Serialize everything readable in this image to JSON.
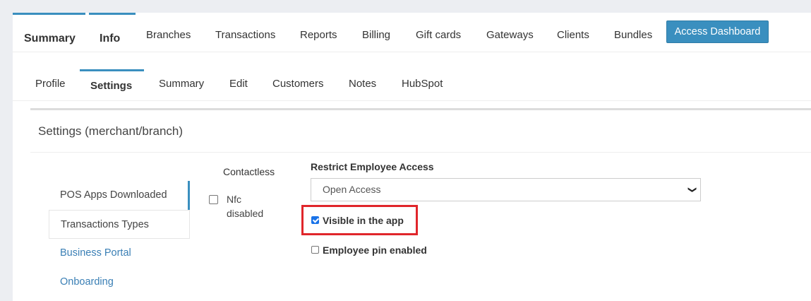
{
  "top_tabs": [
    {
      "label": "Summary",
      "active": true
    },
    {
      "label": "Info",
      "active": true
    },
    {
      "label": "Branches"
    },
    {
      "label": "Transactions"
    },
    {
      "label": "Reports"
    },
    {
      "label": "Billing"
    },
    {
      "label": "Gift cards"
    },
    {
      "label": "Gateways"
    },
    {
      "label": "Clients"
    },
    {
      "label": "Bundles"
    }
  ],
  "access_dashboard_label": "Access Dashboard",
  "sub_tabs": [
    {
      "label": "Profile"
    },
    {
      "label": "Settings",
      "active": true
    },
    {
      "label": "Summary"
    },
    {
      "label": "Edit"
    },
    {
      "label": "Customers"
    },
    {
      "label": "Notes"
    },
    {
      "label": "HubSpot"
    }
  ],
  "panel_title": "Settings (merchant/branch)",
  "side_tabs": [
    {
      "label": "POS Apps Downloaded"
    },
    {
      "label": "Transactions Types"
    },
    {
      "label": "Business Portal"
    },
    {
      "label": "Onboarding"
    }
  ],
  "contactless": {
    "label": "Contactless",
    "nfc_label": "Nfc disabled",
    "nfc_checked": false
  },
  "restrict_access": {
    "label": "Restrict Employee Access",
    "selected": "Open Access"
  },
  "visible_in_app": {
    "label": "Visible in the app",
    "checked": true
  },
  "employee_pin": {
    "label": "Employee pin enabled",
    "checked": false
  },
  "colors": {
    "accent": "#3a8fbf",
    "highlight": "#e0262b",
    "link": "#3a7fb5"
  }
}
